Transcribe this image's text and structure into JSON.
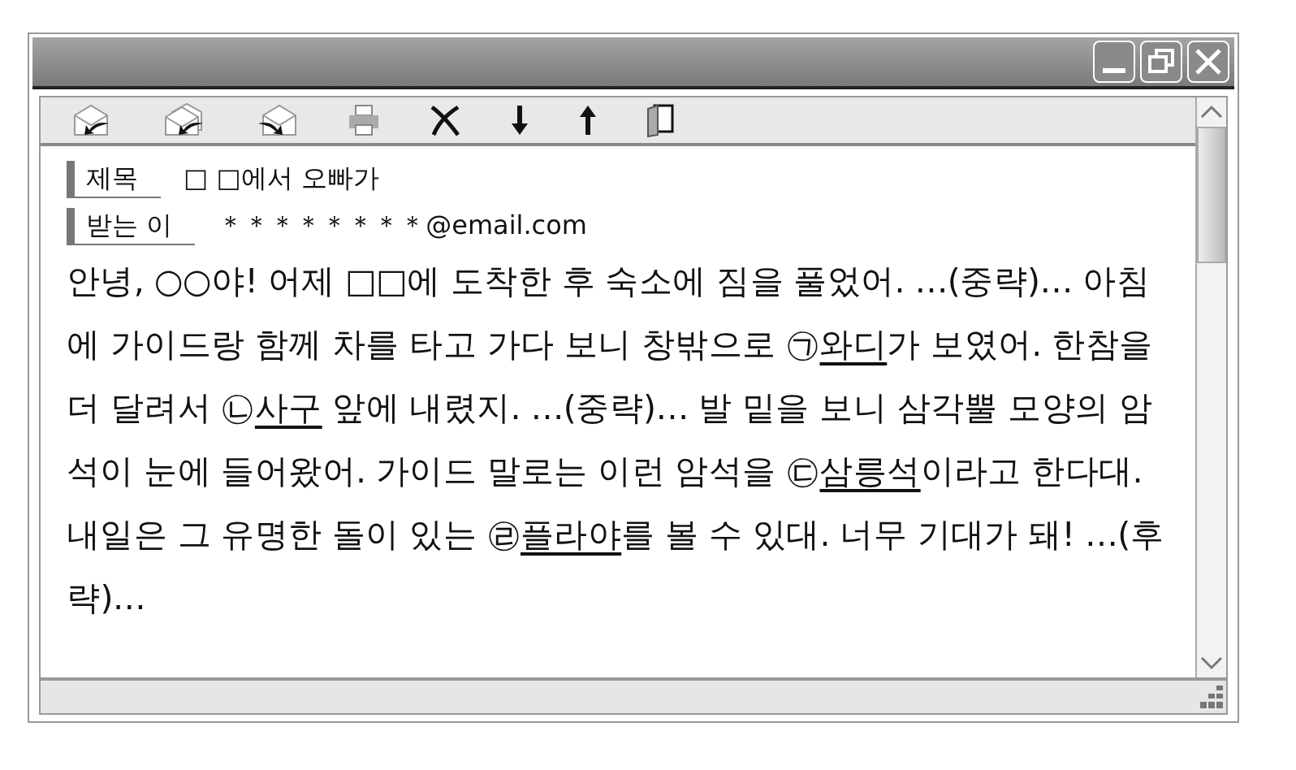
{
  "header": [
    {
      "label": "제목",
      "value": "□ □에서 오빠가"
    },
    {
      "label": "받는 이",
      "value": "＊＊＊＊＊＊＊＊@email.com"
    }
  ],
  "body": [
    {
      "text": "안녕, ○○야! 어제 □□에 도착한 후 숙소에 짐을 풀었어. …(중략)… 아침에 가이드랑 함께 차를 타고 가다 보니 창밖으로 ㉠",
      "underline": false
    },
    {
      "text": "와디",
      "underline": true
    },
    {
      "text": "가 보였어. 한참을 더 달려서 ㉡",
      "underline": false
    },
    {
      "text": "사구",
      "underline": true
    },
    {
      "text": " 앞에 내렸지. …(중략)… 발 밑을 보니 삼각뿔 모양의 암석이 눈에 들어왔어. 가이드 말로는 이런 암석을 ㉢",
      "underline": false
    },
    {
      "text": "삼릉석",
      "underline": true
    },
    {
      "text": "이라고 한다대. 내일은 그 유명한 돌이 있는 ㉣",
      "underline": false
    },
    {
      "text": "플라야",
      "underline": true
    },
    {
      "text": "를 볼 수 있대. 너무 기대가 돼! …(후략)…",
      "underline": false
    }
  ]
}
